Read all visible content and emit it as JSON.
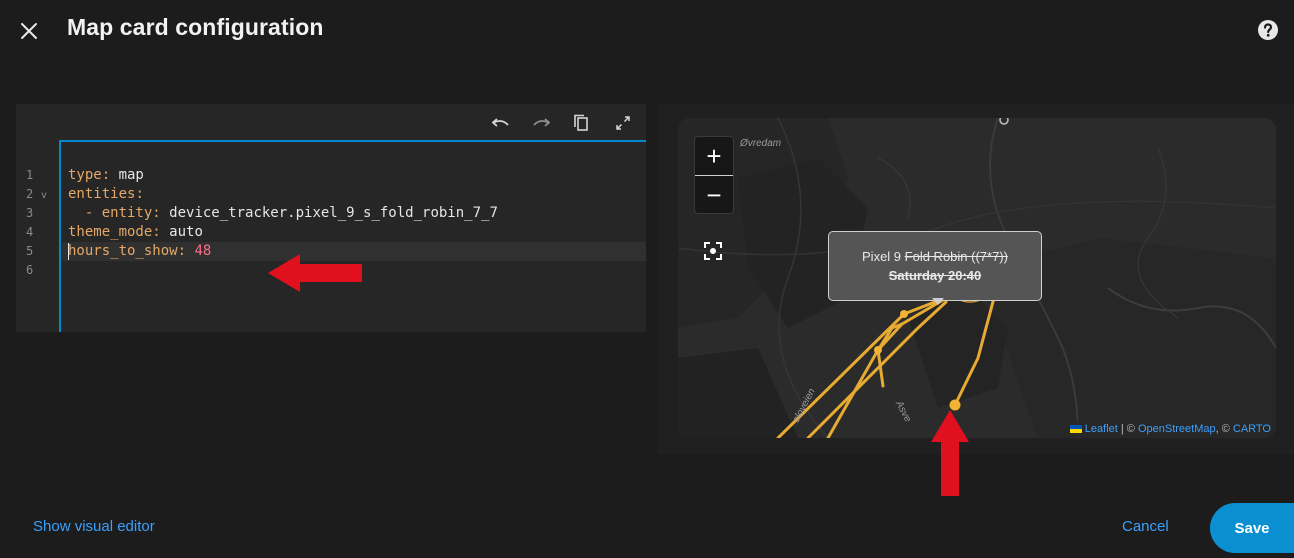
{
  "header": {
    "title": "Map card configuration",
    "close_icon": "close-icon",
    "help_icon": "help-circle-icon"
  },
  "editor": {
    "toolbar_icons": [
      "undo-icon",
      "redo-icon",
      "copy-icon",
      "expand-icon"
    ],
    "line_numbers": [
      "1",
      "2",
      "3",
      "4",
      "5",
      "6"
    ],
    "lines": [
      {
        "key": "type",
        "sep": ": ",
        "value": "map"
      },
      {
        "key": "entities",
        "sep": ":",
        "value": ""
      },
      {
        "prefix": "  - ",
        "key": "entity",
        "sep": ": ",
        "value": "device_tracker.pixel_9_s_fold_robin_7_7"
      },
      {
        "key": "theme_mode",
        "sep": ": ",
        "value": "auto"
      },
      {
        "key": "hours_to_show",
        "sep": ": ",
        "value": "48"
      },
      {
        "key": "",
        "sep": "",
        "value": ""
      }
    ]
  },
  "map": {
    "zoom_in": "+",
    "zoom_out": "−",
    "place_labels": [
      "Øvredam",
      "sloveien",
      "Asve"
    ],
    "popup": {
      "line1_plain": "Pixel 9 ",
      "line1_struck": "Fold Robin ((7*7))",
      "line2": "Saturday 20:40"
    },
    "attribution": {
      "leaflet": "Leaflet",
      "separator": " | © ",
      "osm": "OpenStreetMap",
      "separator2": ", © ",
      "carto": "CARTO"
    },
    "track_color": "#f2b233"
  },
  "footer": {
    "show_visual_editor": "Show visual editor",
    "cancel": "Cancel",
    "save": "Save"
  },
  "colors": {
    "accent": "#0a8fd0",
    "link": "#3aa0ff",
    "annotation_arrow": "#e0101e"
  }
}
